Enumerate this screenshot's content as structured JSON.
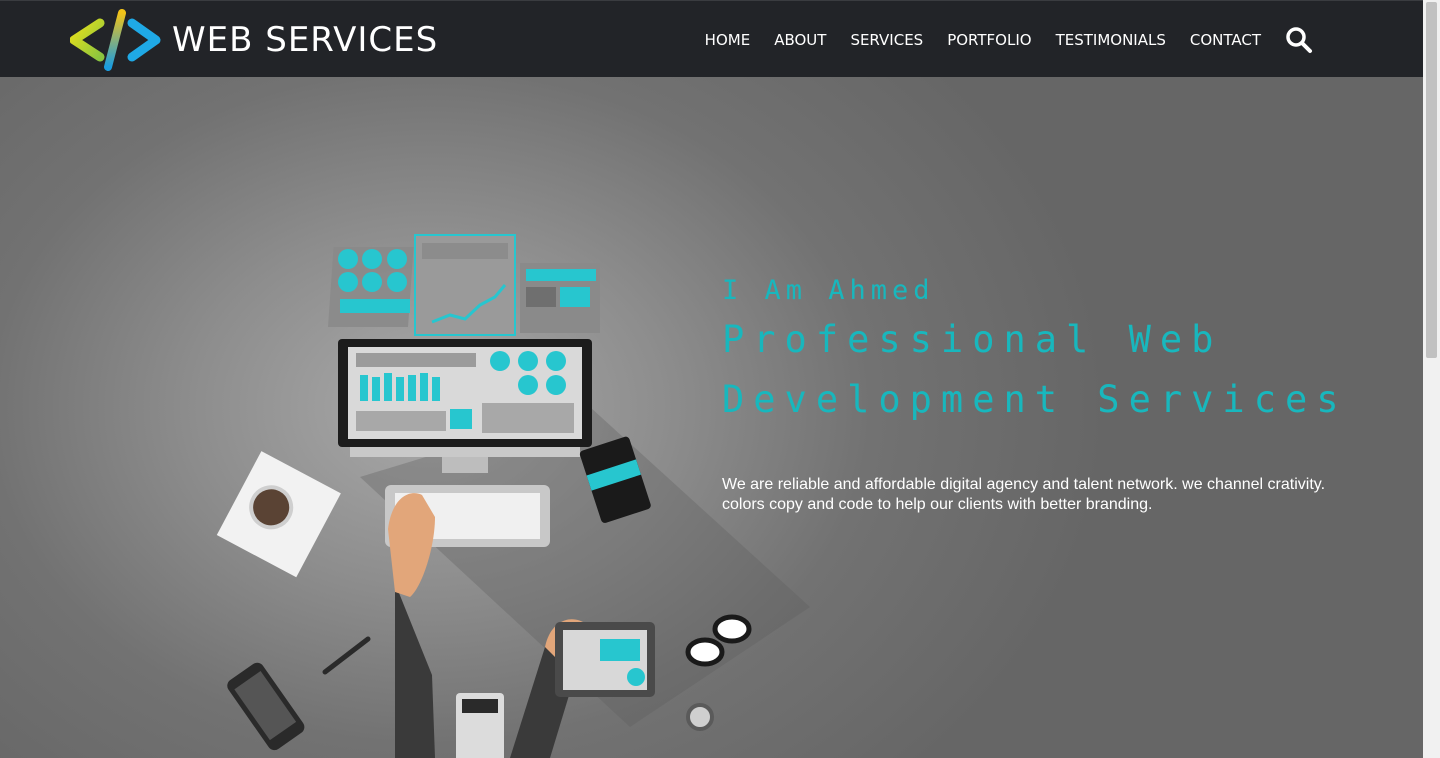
{
  "header": {
    "logo_text": "WEB SERVICES",
    "logo_icon": "code-brackets-icon",
    "nav_items": [
      {
        "label": "HOME"
      },
      {
        "label": "ABOUT"
      },
      {
        "label": "SERVICES"
      },
      {
        "label": "PORTFOLIO"
      },
      {
        "label": "TESTIMONIALS"
      },
      {
        "label": "CONTACT"
      }
    ],
    "search_icon": "search-icon"
  },
  "hero": {
    "intro": "I Am Ahmed",
    "headline_line1": "Professional Web",
    "headline_line2": "Development Services",
    "description": "We are reliable and affordable digital agency and talent network. we channel crativity. colors copy and code to help our clients with better branding."
  },
  "colors": {
    "navbar": "#222428",
    "accent": "#18b7bd",
    "hero_bg": "#6a6a6a",
    "text": "#ffffff"
  }
}
